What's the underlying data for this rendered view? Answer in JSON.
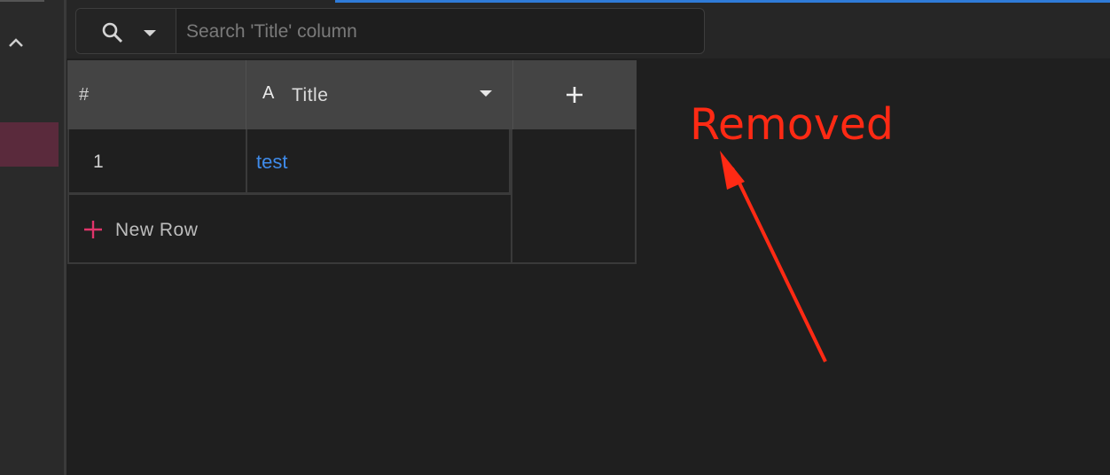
{
  "search": {
    "placeholder": "Search 'Title' column",
    "scope_icon": "search-icon",
    "scope_dropdown_icon": "caret-down-icon"
  },
  "grid": {
    "columns": [
      {
        "label": "#"
      },
      {
        "label": "Title",
        "type_icon": "A"
      }
    ],
    "add_column_icon": "plus-icon",
    "rows": [
      {
        "number": "1",
        "title": "test"
      }
    ],
    "new_row_label": "New Row"
  },
  "annotation": {
    "text": "Removed",
    "color": "#ff2a14"
  },
  "colors": {
    "accent_blue": "#2f7bd8",
    "link_blue": "#3f8bea",
    "new_row_plus": "#e0346a",
    "sidebar_active": "#5a2a3c"
  }
}
